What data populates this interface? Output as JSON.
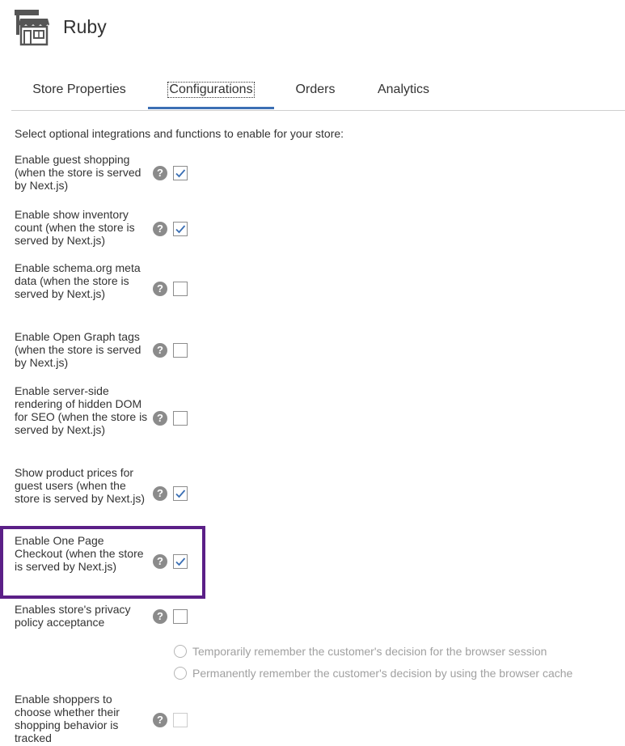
{
  "store": {
    "name": "Ruby",
    "icon": "storefront-icon"
  },
  "tabs": [
    {
      "label": "Store Properties",
      "active": false
    },
    {
      "label": "Configurations",
      "active": true
    },
    {
      "label": "Orders",
      "active": false
    },
    {
      "label": "Analytics",
      "active": false
    }
  ],
  "intro_text": "Select optional integrations and functions to enable for your store:",
  "options": [
    {
      "label": "Enable guest shopping (when the store is served by Next.js)",
      "checked": true,
      "disabled": false
    },
    {
      "label": "Enable show inventory count (when the store is served by Next.js)",
      "checked": true,
      "disabled": false
    },
    {
      "label": "Enable schema.org meta data (when the store is served by Next.js)",
      "checked": false,
      "disabled": false
    },
    {
      "label": "Enable Open Graph tags (when the store is served by Next.js)",
      "checked": false,
      "disabled": false
    },
    {
      "label": "Enable server-side rendering of hidden DOM for SEO (when the store is served by Next.js)",
      "checked": false,
      "disabled": false
    },
    {
      "label": "Show product prices for guest users (when the store is served by Next.js)",
      "checked": true,
      "disabled": false
    },
    {
      "label": "Enable One Page Checkout (when the store is served by Next.js)",
      "checked": true,
      "disabled": false,
      "highlighted": true
    },
    {
      "label": "Enables store's privacy policy acceptance",
      "checked": false,
      "disabled": false
    },
    {
      "label": "Enable shoppers to choose whether their shopping behavior is tracked",
      "checked": false,
      "disabled": true
    }
  ],
  "privacy_radio_options": [
    {
      "label": "Temporarily remember the customer's decision for the browser session",
      "selected": false,
      "disabled": true
    },
    {
      "label": "Permanently remember the customer's decision by using the browser cache",
      "selected": false,
      "disabled": true
    }
  ],
  "icons": {
    "help": "help-icon",
    "help_glyph": "?",
    "check": "check-icon"
  },
  "colors": {
    "accent": "#3b6fb4",
    "highlight": "#5b1f87",
    "help_icon": "#8b8b8b",
    "disabled_text": "#a0a0a0"
  }
}
